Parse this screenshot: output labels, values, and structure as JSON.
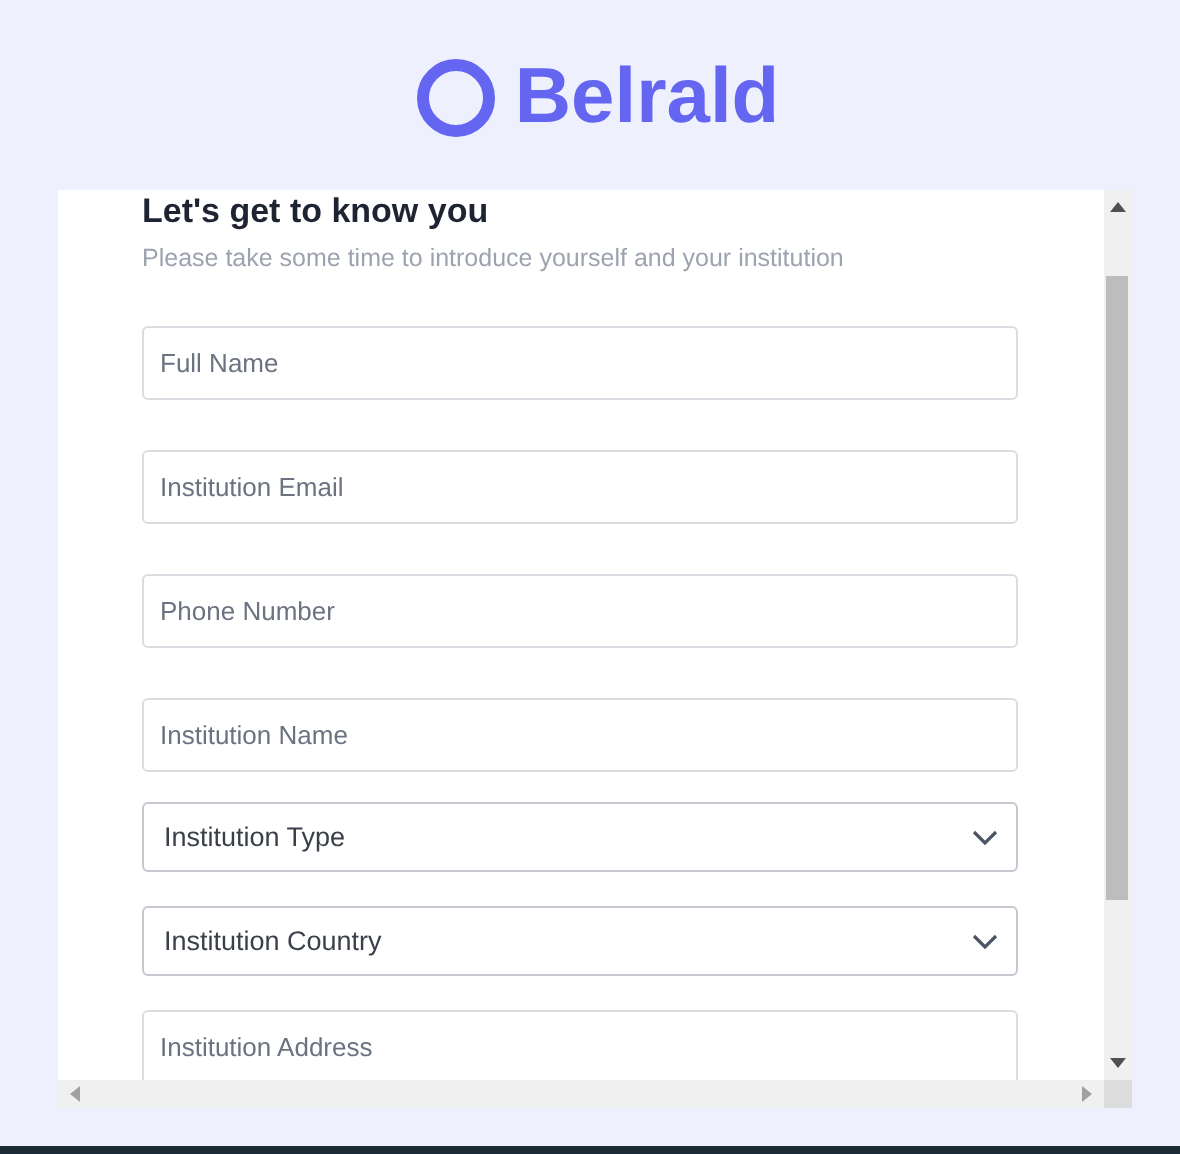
{
  "logo": {
    "text": "Belrald"
  },
  "form": {
    "heading": "Let's get to know you",
    "subtitle": "Please take some time to introduce yourself and your institution",
    "fields": [
      {
        "kind": "input",
        "placeholder": "Full Name"
      },
      {
        "kind": "input",
        "placeholder": "Institution Email"
      },
      {
        "kind": "input",
        "placeholder": "Phone Number"
      },
      {
        "kind": "input",
        "placeholder": "Institution Name"
      },
      {
        "kind": "select",
        "value": "Institution Type"
      },
      {
        "kind": "select",
        "value": "Institution Country"
      },
      {
        "kind": "input",
        "placeholder": "Institution Address"
      }
    ]
  }
}
